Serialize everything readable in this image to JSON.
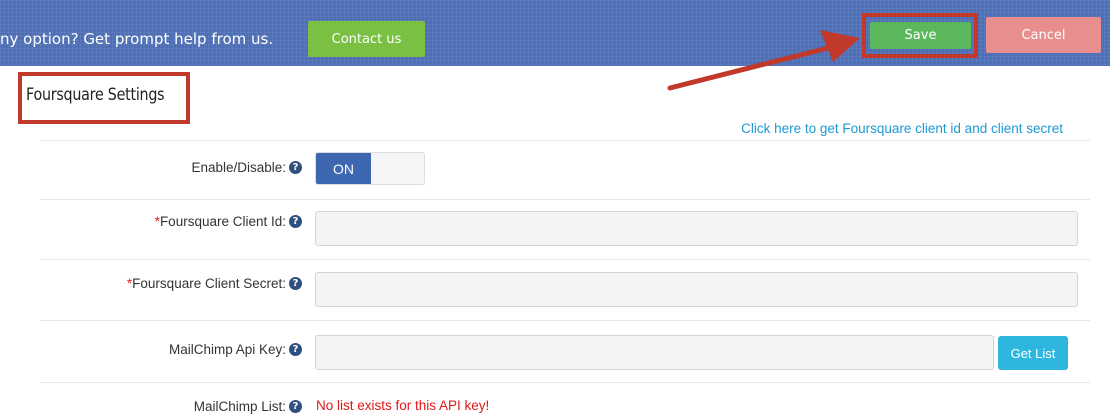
{
  "topbar": {
    "help_text": "ny option? Get prompt help from us.",
    "contact_label": "Contact us",
    "save_label": "Save",
    "cancel_label": "Cancel"
  },
  "section": {
    "title": "Foursquare Settings",
    "help_link": "Click here to get Foursquare client id and client secret"
  },
  "fields": {
    "enable": {
      "label": "Enable/Disable:",
      "toggle_on": "ON"
    },
    "client_id": {
      "required_mark": "*",
      "label": "Foursquare Client Id:",
      "value": ""
    },
    "client_secret": {
      "required_mark": "*",
      "label": "Foursquare Client Secret:",
      "value": ""
    },
    "mailchimp_key": {
      "label": "MailChimp Api Key:",
      "value": "",
      "button": "Get List"
    },
    "mailchimp_list": {
      "label": "MailChimp List:",
      "error": "No list exists for this API key!"
    }
  },
  "icons": {
    "help": "?"
  },
  "colors": {
    "topbar": "#4e6fb6",
    "contact_button": "#7ac143",
    "save_button": "#5cb85c",
    "cancel_button": "#e88e8e",
    "highlight": "#c0392b",
    "link": "#1c9ad6",
    "error": "#e01818"
  }
}
